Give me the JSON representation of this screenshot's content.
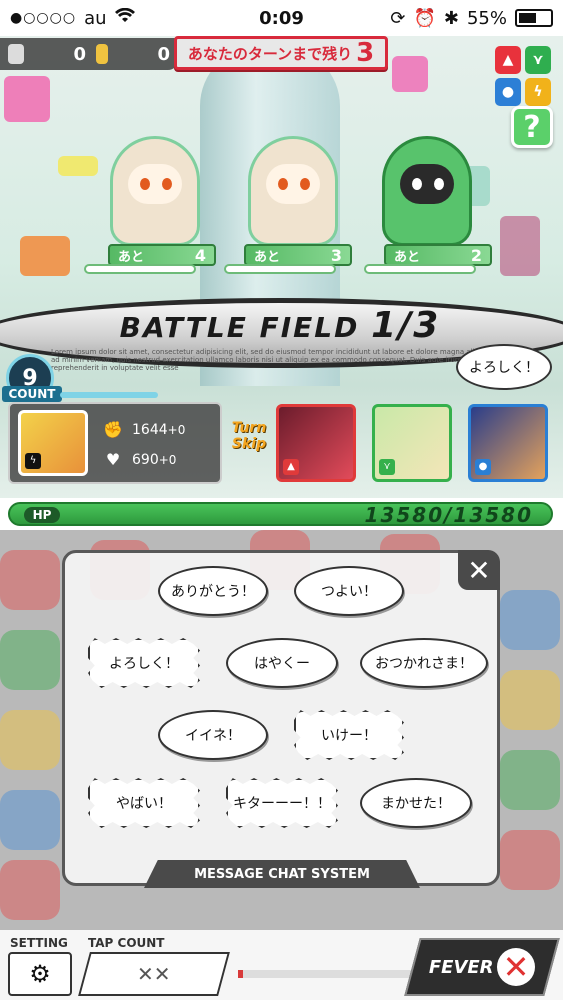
{
  "status_bar": {
    "signal": "●○○○○",
    "carrier": "au",
    "wifi_icon": "wifi-icon",
    "time": "0:09",
    "battery_percent": "55%",
    "battery_level": 0.55
  },
  "top_counter": {
    "left_value": "0",
    "right_value": "0"
  },
  "turn_banner": {
    "label": "あなたのターンまで残り",
    "turns": "3"
  },
  "elements": [
    {
      "name": "fire",
      "color": "#e8323c"
    },
    {
      "name": "wind",
      "color": "#2fae4f"
    },
    {
      "name": "water",
      "color": "#2c7fd6"
    },
    {
      "name": "thunder",
      "color": "#f1b21a"
    }
  ],
  "help": {
    "label": "?"
  },
  "enemies": [
    {
      "ato_label": "あと",
      "ato_count": "4",
      "color": "#f0e3cf",
      "accent": "#7fcf9e"
    },
    {
      "ato_label": "あと",
      "ato_count": "3",
      "color": "#f0e3cf",
      "accent": "#7fcf9e"
    },
    {
      "ato_label": "あと",
      "ato_count": "2",
      "color": "#58c36c",
      "accent": "#2b8a3e"
    }
  ],
  "battlefield": {
    "title": "BATTLE FIELD",
    "stage": "1/3",
    "lorem": "Lorem ipsum dolor sit amet, consectetur adipisicing elit, sed do eiusmod tempor incididunt ut labore et dolore magna aliqua. Ut enim ad minim veniam, quis nostrud exercitation ullamco laboris nisi ut aliquip ex ea commodo consequat. Duis aute irure dolor in reprehenderit in voluptate velit esse"
  },
  "speech_small": "よろしく！",
  "count": {
    "value": "9",
    "label": "COUNT"
  },
  "player": {
    "attack": "1644",
    "attack_bonus": "+0",
    "heal": "690",
    "heal_bonus": "+0",
    "attack_icon": "fist-icon",
    "heal_icon": "heart-icon"
  },
  "turn_skip": {
    "line1": "Turn",
    "line2": "Skip"
  },
  "allies": [
    {
      "border": "#e03a3a",
      "element": "fire"
    },
    {
      "border": "#35b04c",
      "element": "wind"
    },
    {
      "border": "#2a7fd4",
      "element": "water"
    }
  ],
  "hp": {
    "label": "HP",
    "value": "13580/13580",
    "fraction": 1.0
  },
  "chat": {
    "title": "MESSAGE CHAT SYSTEM",
    "close": "✕",
    "messages": [
      "ありがとう！",
      "つよい！",
      "よろしく！",
      "はやくー",
      "おつかれさま！",
      "イイネ！",
      "いけー！",
      "やばい！",
      "キターーー！！",
      "まかせた！"
    ]
  },
  "bottom": {
    "setting_label": "SETTING",
    "tap_count_label": "TAP COUNT",
    "fever_label": "FEVER",
    "fever_x": "✕",
    "fever_progress": 0.03
  }
}
